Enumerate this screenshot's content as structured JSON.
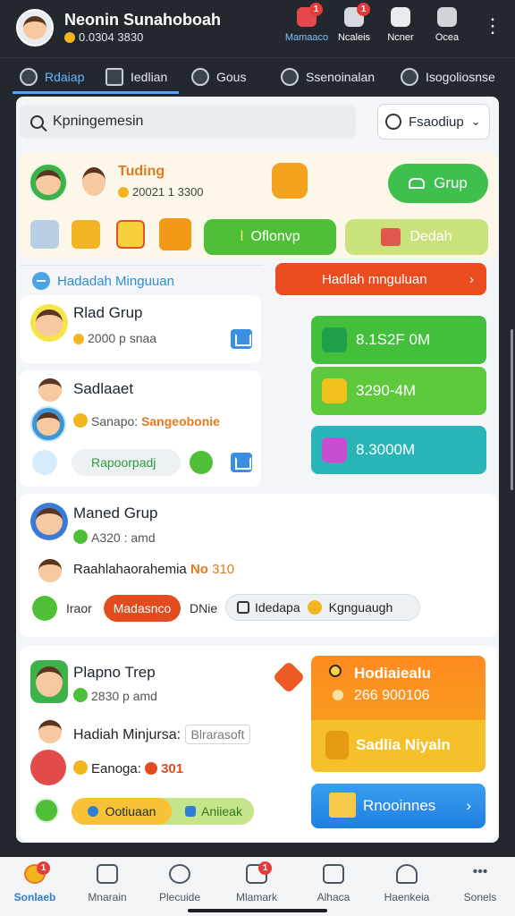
{
  "header": {
    "name": "Neonin Sunahoboah",
    "coins": "0.0304 3830",
    "icons": [
      {
        "label": "Mamaaco",
        "badge": "1",
        "icon": "bell-icon"
      },
      {
        "label": "Ncaleis",
        "badge": "1",
        "icon": "message-icon"
      },
      {
        "label": "Ncner",
        "badge": "",
        "icon": "home-icon"
      },
      {
        "label": "Ocea",
        "badge": "",
        "icon": "ship-icon"
      }
    ]
  },
  "tabs": [
    {
      "label": "Rdaiap",
      "icon": "search-tab-icon"
    },
    {
      "label": "Iedlian",
      "icon": "square-tab-icon"
    },
    {
      "label": "Gous",
      "icon": "chat-tab-icon"
    },
    {
      "label": "Ssenoinalan",
      "icon": "globe-tab-icon"
    },
    {
      "label": "Isogoliosnse",
      "icon": "people-tab-icon"
    }
  ],
  "search": {
    "value": "Kpningemesin"
  },
  "filter": {
    "label": "Fsaodiup"
  },
  "top_card": {
    "title": "Tuding",
    "sub": "20021 1 3300",
    "grup_button": "Grup",
    "green_button": "Oflonvp",
    "dedah_button": "Dedah"
  },
  "section": {
    "label": "Hadadah Minguuan",
    "banner": "Hadlah mnguluan"
  },
  "rows": {
    "r1_name": "Rlad Grup",
    "r1_meta": "2000 p snaa",
    "r2_name": "Sadlaaet",
    "r2_meta_prefix": "Sanapo:",
    "r2_meta_highlight": "Sangeobonie",
    "r2_pill": "Rapoorpadj",
    "r3_name": "Maned Grup",
    "r3_meta": "A320 : amd",
    "r3_line": "Raahlahaorahemia",
    "r3_line_tag": "No",
    "r3_line_val": "310",
    "r3_pill1_prefix": "Iraor",
    "r3_pill1": "Madasnco",
    "r3_pill1_suffix": "DNie",
    "r3_pill2": "Idedapa",
    "r3_pill2_suffix": "Kgnguaugh",
    "r4_name": "Plapno Trep",
    "r4_meta": "2830 p amd",
    "r4_line": "Hadiah Minjursa:",
    "r4_line_tag": "Blrarasoft",
    "r4_line2_prefix": "Eanoga:",
    "r4_line2_val": "301",
    "r4_pill1": "Ootiuaan",
    "r4_pill2": "Aniieak"
  },
  "stats": [
    {
      "value": "8.1S2F 0M",
      "color": "#43bf3c"
    },
    {
      "value": "3290-4M",
      "color": "#5fc93d"
    },
    {
      "value": "8.3000M",
      "color": "#29b5b8"
    }
  ],
  "promo": {
    "line1": "Hodiaiealu",
    "line2": "266 900106",
    "line3": "Sadlia Niyaln",
    "blue": "Rnooinnes"
  },
  "bottom_nav": [
    {
      "label": "Sonlaeb",
      "badge": "1"
    },
    {
      "label": "Mnarain",
      "badge": ""
    },
    {
      "label": "Plecuide",
      "badge": ""
    },
    {
      "label": "Mlamark",
      "badge": "1"
    },
    {
      "label": "Alhaca",
      "badge": ""
    },
    {
      "label": "Haenkeia",
      "badge": ""
    },
    {
      "label": "Sonels",
      "badge": ""
    }
  ]
}
